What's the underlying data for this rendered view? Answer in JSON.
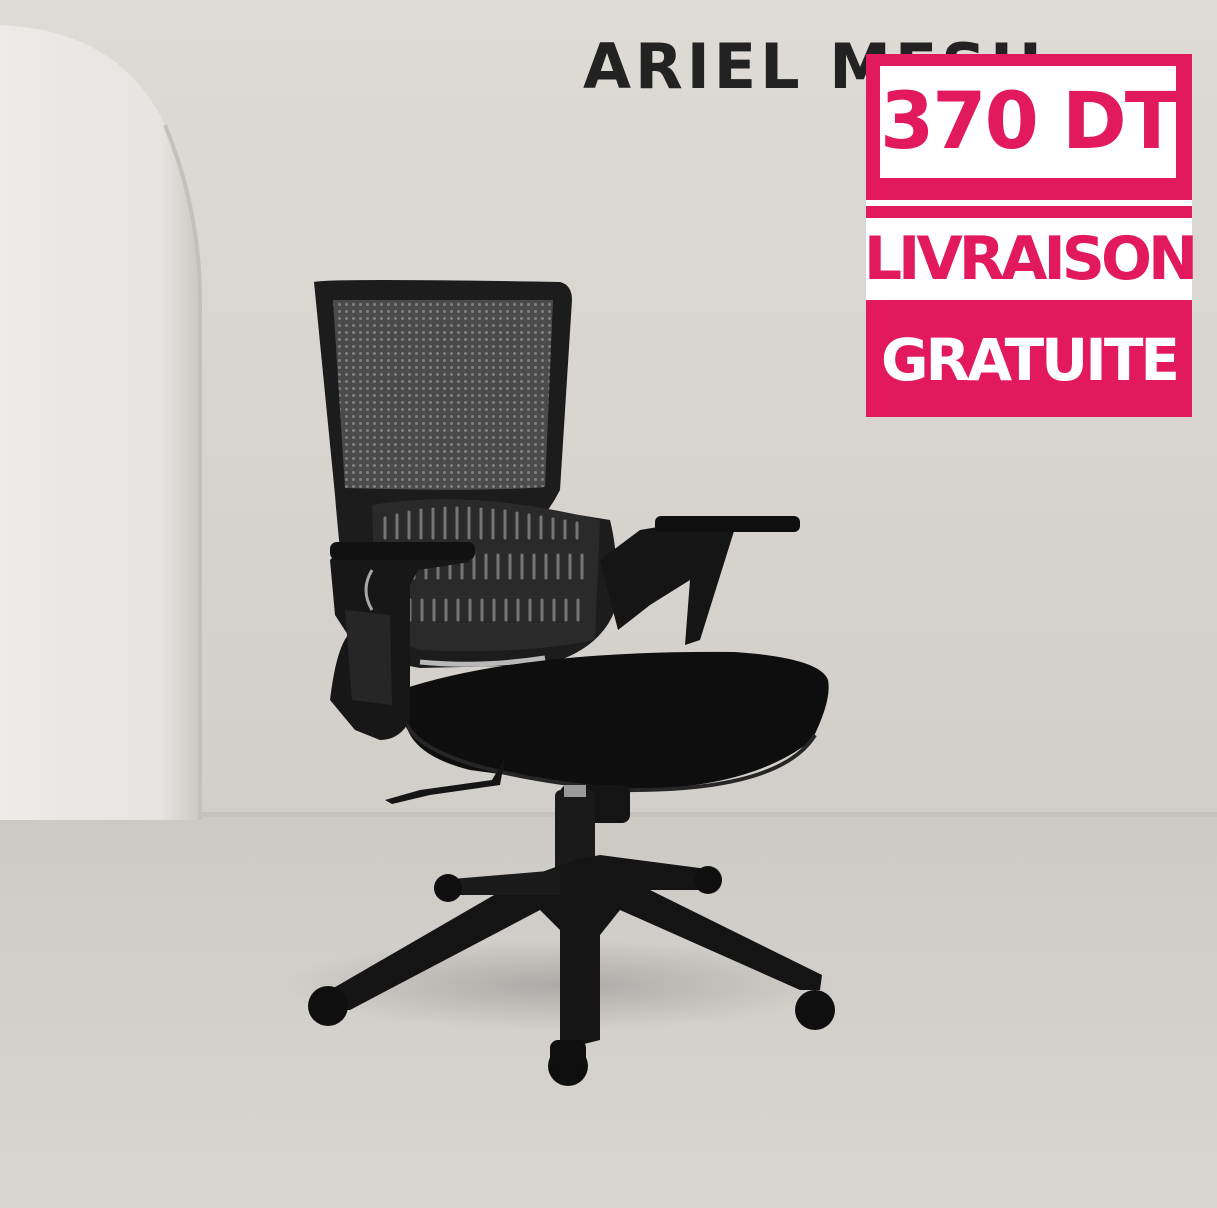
{
  "brand": {
    "text": "ARIEL MESH"
  },
  "promo": {
    "price": "370 DT",
    "delivery_line1": "LIVRAISON",
    "delivery_line2": "GRATUITE",
    "accent_color": "#e3195d"
  },
  "product": {
    "icon": "office-chair-icon"
  }
}
